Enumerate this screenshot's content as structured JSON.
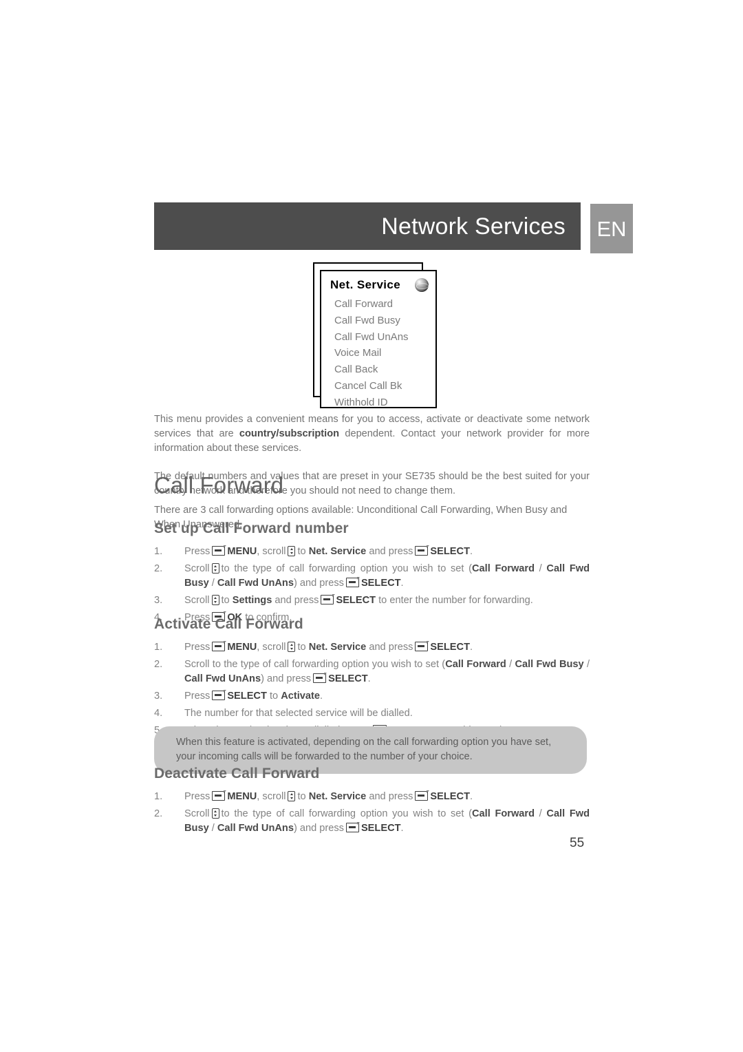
{
  "header": {
    "title": "Network Services",
    "language_tab": "EN",
    "bar_color": "#4d4d4d",
    "tab_color": "#969696"
  },
  "menu_illustration": {
    "title": "Net. Service",
    "icon": "globe-icon",
    "items": [
      "Call Forward",
      "Call Fwd Busy",
      "Call Fwd UnAns",
      "Voice Mail",
      "Call Back",
      "Cancel Call Bk",
      "Withhold ID"
    ]
  },
  "intro": {
    "paragraph1_part1": "This menu provides a convenient means for you to access, activate or deactivate some network services that are ",
    "paragraph1_bold": "country/subscription",
    "paragraph1_part2": " dependent. Contact your network provider for more information about these services.",
    "paragraph2": "The default numbers and values that are preset in your SE735 should be the best suited for your country network and therefore you should not need to change them."
  },
  "chapter": {
    "title": "Call Forward",
    "intro": "There are 3 call forwarding options available: Unconditional Call Forwarding, When Busy and When Unanswered."
  },
  "sections": [
    {
      "heading": "Set up Call Forward number",
      "steps": [
        {
          "num": "1.",
          "text": "Press  MENU, scroll  to Net. Service and press  SELECT."
        },
        {
          "num": "2.",
          "text": "Scroll  to the type of call forwarding option you wish to set (Call Forward / Call Fwd Busy / Call Fwd UnAns) and press  SELECT."
        },
        {
          "num": "3.",
          "text": "Scroll  to Settings and press  SELECT to enter the number for forwarding."
        },
        {
          "num": "4.",
          "text": "Press  OK to confirm."
        }
      ]
    },
    {
      "heading": "Activate Call Forward",
      "steps": [
        {
          "num": "1.",
          "text": "Press  MENU, scroll  to Net. Service and press  SELECT."
        },
        {
          "num": "2.",
          "text": "Scroll to the type of call forwarding option you wish to set (Call Forward / Call Fwd Busy / Call Fwd UnAns) and press  SELECT."
        },
        {
          "num": "3.",
          "text": "Press  SELECT to Activate."
        },
        {
          "num": "4.",
          "text": "The number for that selected service will be dialled."
        },
        {
          "num": "5.",
          "text": "When the number has been dialled, press  to return to stand-by mode."
        }
      ]
    },
    {
      "heading": "Deactivate Call Forward",
      "steps": [
        {
          "num": "1.",
          "text": "Press  MENU, scroll  to Net. Service and press  SELECT."
        },
        {
          "num": "2.",
          "text": "Scroll  to the type of call forwarding option you wish to set (Call Forward / Call Fwd Busy / Call Fwd UnAns) and press  SELECT."
        }
      ]
    }
  ],
  "labels": {
    "press": "Press",
    "scroll": "Scroll",
    "scroll_lc": "scroll",
    "to": "to",
    "and_press": "and press",
    "menu": "MENU",
    "select": "SELECT",
    "ok": "OK",
    "net_service": "Net. Service",
    "settings": "Settings",
    "activate": "Activate",
    "call_forward": "Call Forward",
    "call_fwd_busy": "Call Fwd Busy",
    "call_fwd_unans": "Call Fwd UnAns",
    "step1_tail": ".",
    "step2_lead": "to the type of call forwarding option you wish to set (",
    "step2_sep": " / ",
    "step2_tail": ") and press",
    "step3_setup_tail": "to enter the number for forwarding.",
    "step4_setup_tail": "to confirm.",
    "step3_activate_tail": "to",
    "step4_activate": "The number for that selected service will be dialled.",
    "step5_activate_lead": "When the number has been dialled, press",
    "step5_activate_tail": "to return to stand-by mode.",
    "step2_activate_lead": "Scroll to the type of call forwarding option you wish to set ("
  },
  "note": {
    "text": "When this feature is activated, depending on the call forwarding option you have set, your incoming calls will be forwarded to the number of your choice."
  },
  "page_number": "55"
}
